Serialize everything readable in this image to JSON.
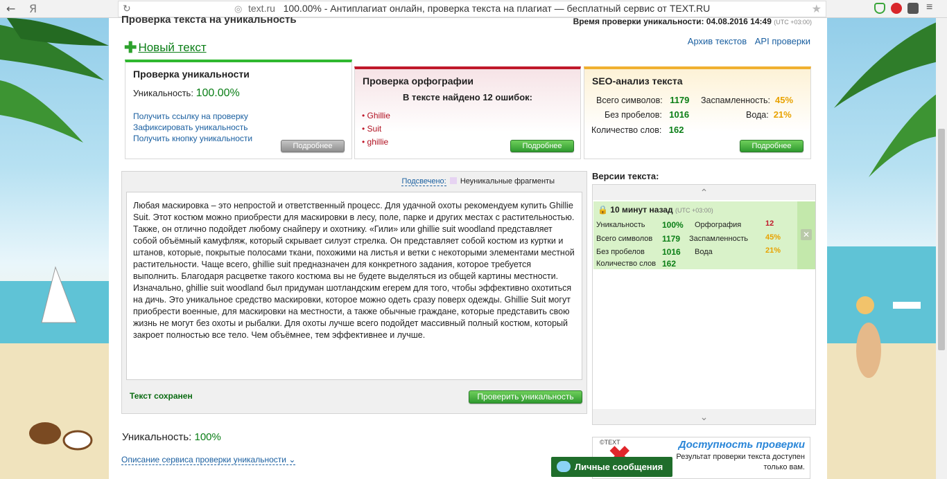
{
  "browser": {
    "back_glyph": "←",
    "yandex_glyph": "Я",
    "host": "text.ru",
    "title": "100.00% - Антиплагиат онлайн, проверка текста на плагиат — бесплатный сервис от TEXT.RU"
  },
  "page": {
    "heading": "Проверка текста на уникальность",
    "check_time_label": "Время проверки уникальности: 04.08.2016 14:49",
    "check_time_tz": "(UTC +03:00)",
    "new_text_link": "Новый текст",
    "archive_link": "Архив текстов",
    "api_link": "API проверки"
  },
  "uniqueness_card": {
    "title": "Проверка уникальности",
    "label": "Уникальность:",
    "value": "100.00%",
    "links": [
      "Получить ссылку на проверку",
      "Зафиксировать уникальность",
      "Получить кнопку уникальности"
    ],
    "more_button": "Подробнее"
  },
  "spelling_card": {
    "title": "Проверка орфографии",
    "found": "В тексте найдено 12 ошибок:",
    "errors": [
      "Ghillie",
      "Suit",
      "ghillie"
    ],
    "more_button": "Подробнее"
  },
  "seo_card": {
    "title": "SEO-анализ текста",
    "chars_label": "Всего символов:",
    "chars_value": "1179",
    "nospace_label": "Без пробелов:",
    "nospace_value": "1016",
    "words_label": "Количество слов:",
    "words_value": "162",
    "spam_label": "Заспамленность:",
    "spam_value": "45%",
    "water_label": "Вода:",
    "water_value": "21%",
    "more_button": "Подробнее"
  },
  "editor": {
    "highlight_label": "Подсвечено:",
    "highlight_legend": "Неуникальные фрагменты",
    "text": "Любая маскировка – это непростой и ответственный процесс. Для удачной охоты рекомендуем купить Ghillie Suit. Этот костюм можно приобрести для маскировки в лесу, поле, парке и других местах с растительностью. Также, он отлично подойдет любому снайперу и охотнику. «Гили» или ghillie suit woodland представляет собой объёмный камуфляж, который скрывает силуэт стрелка. Он представляет собой костюм из куртки и штанов, которые, покрытые полосами ткани, похожими на листья и ветки с некоторыми элементами местной растительности. Чаще всего, ghillie suit предназначен для конкретного задания, которое требуется выполнить.  Благодаря расцветке такого костюма вы не будете выделяться из общей картины местности. Изначально, ghillie suit woodland был придуман шотландским егерем для того, чтобы эффективно охотиться на дичь. Это уникальное средство маскировки, которое можно одеть сразу поверх одежды. Ghillie Suit могут приобрести военные, для маскировки на местности, а также обычные граждане, которые представить свою жизнь не могут без охоты и рыбалки. Для охоты лучше всего подойдет массивный полный костюм, который закроет полностью все тело. Чем объёмнее, тем эффективнее и лучше.",
    "status": "Текст сохранен",
    "check_button": "Проверить уникальность"
  },
  "result": {
    "label": "Уникальность:",
    "value": "100%",
    "description_link": "Описание сервиса проверки уникальности"
  },
  "versions": {
    "title": "Версии текста:",
    "entry": {
      "time": "10 минут назад",
      "tz": "(UTC +03:00)",
      "uniq_label": "Уникальность",
      "uniq_value": "100%",
      "chars_label": "Всего символов",
      "chars_value": "1179",
      "nospace_label": "Без пробелов",
      "nospace_value": "1016",
      "words_label": "Количество слов",
      "words_value": "162",
      "spell_label": "Орфография",
      "spell_value": "12",
      "spam_label": "Заспамленность",
      "spam_value": "45%",
      "water_label": "Вода",
      "water_value": "21%"
    }
  },
  "promo": {
    "logo": "©TEXT",
    "title": "Доступность проверки",
    "text": "Результат проверки текста доступен только вам."
  },
  "messages_button": "Личные сообщения",
  "colors": {
    "green": "#0a7e16",
    "red_accent": "#c0182b",
    "orange": "#e8a200",
    "link": "#1a5fa0"
  }
}
